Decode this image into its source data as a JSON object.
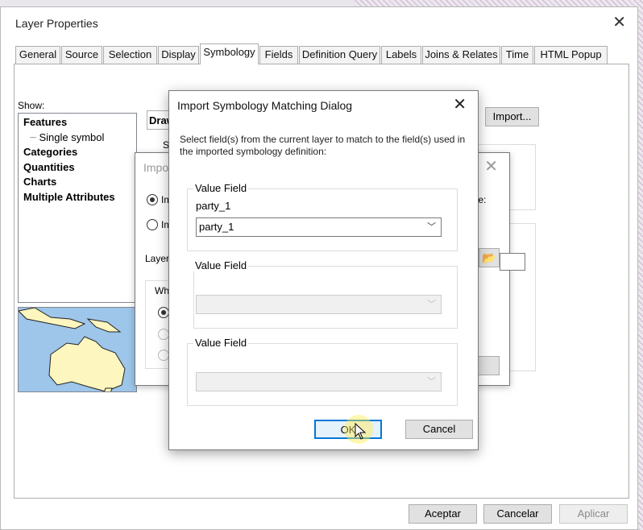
{
  "window": {
    "title": "Layer Properties"
  },
  "tabs": [
    {
      "label": "General"
    },
    {
      "label": "Source"
    },
    {
      "label": "Selection"
    },
    {
      "label": "Display"
    },
    {
      "label": "Symbology"
    },
    {
      "label": "Fields"
    },
    {
      "label": "Definition Query"
    },
    {
      "label": "Labels"
    },
    {
      "label": "Joins & Relates"
    },
    {
      "label": "Time"
    },
    {
      "label": "HTML Popup"
    }
  ],
  "symbology": {
    "show_label": "Show:",
    "show_items": [
      {
        "label": "Features"
      },
      {
        "label": "Single symbol"
      },
      {
        "label": "Categories"
      },
      {
        "label": "Quantities"
      },
      {
        "label": "Charts"
      },
      {
        "label": "Multiple Attributes"
      }
    ],
    "draw_label": "Draw",
    "import_button": "Import...",
    "file_text": "ile:",
    "partial_s": "S"
  },
  "import_dialog": {
    "title_fragment": "Impo",
    "radio1": "Im",
    "radio2": "Im",
    "layer_label": "Layer",
    "where_label": "Wh"
  },
  "matching_dialog": {
    "title": "Import Symbology Matching Dialog",
    "description": "Select field(s) from the current layer to match to the field(s) used in the imported symbology definition:",
    "groups": [
      {
        "label": "Value Field",
        "imported_field": "party_1",
        "selected": "party_1",
        "enabled": true
      },
      {
        "label": "Value Field",
        "imported_field": "",
        "selected": "",
        "enabled": false
      },
      {
        "label": "Value Field",
        "imported_field": "",
        "selected": "",
        "enabled": false
      }
    ],
    "ok": "OK",
    "cancel": "Cancel"
  },
  "footer": {
    "accept": "Aceptar",
    "cancel": "Cancelar",
    "apply": "Aplicar"
  },
  "colors": {
    "ocean": "#9ec5ea",
    "land": "#fdf6bf",
    "focus": "#0078d7"
  }
}
